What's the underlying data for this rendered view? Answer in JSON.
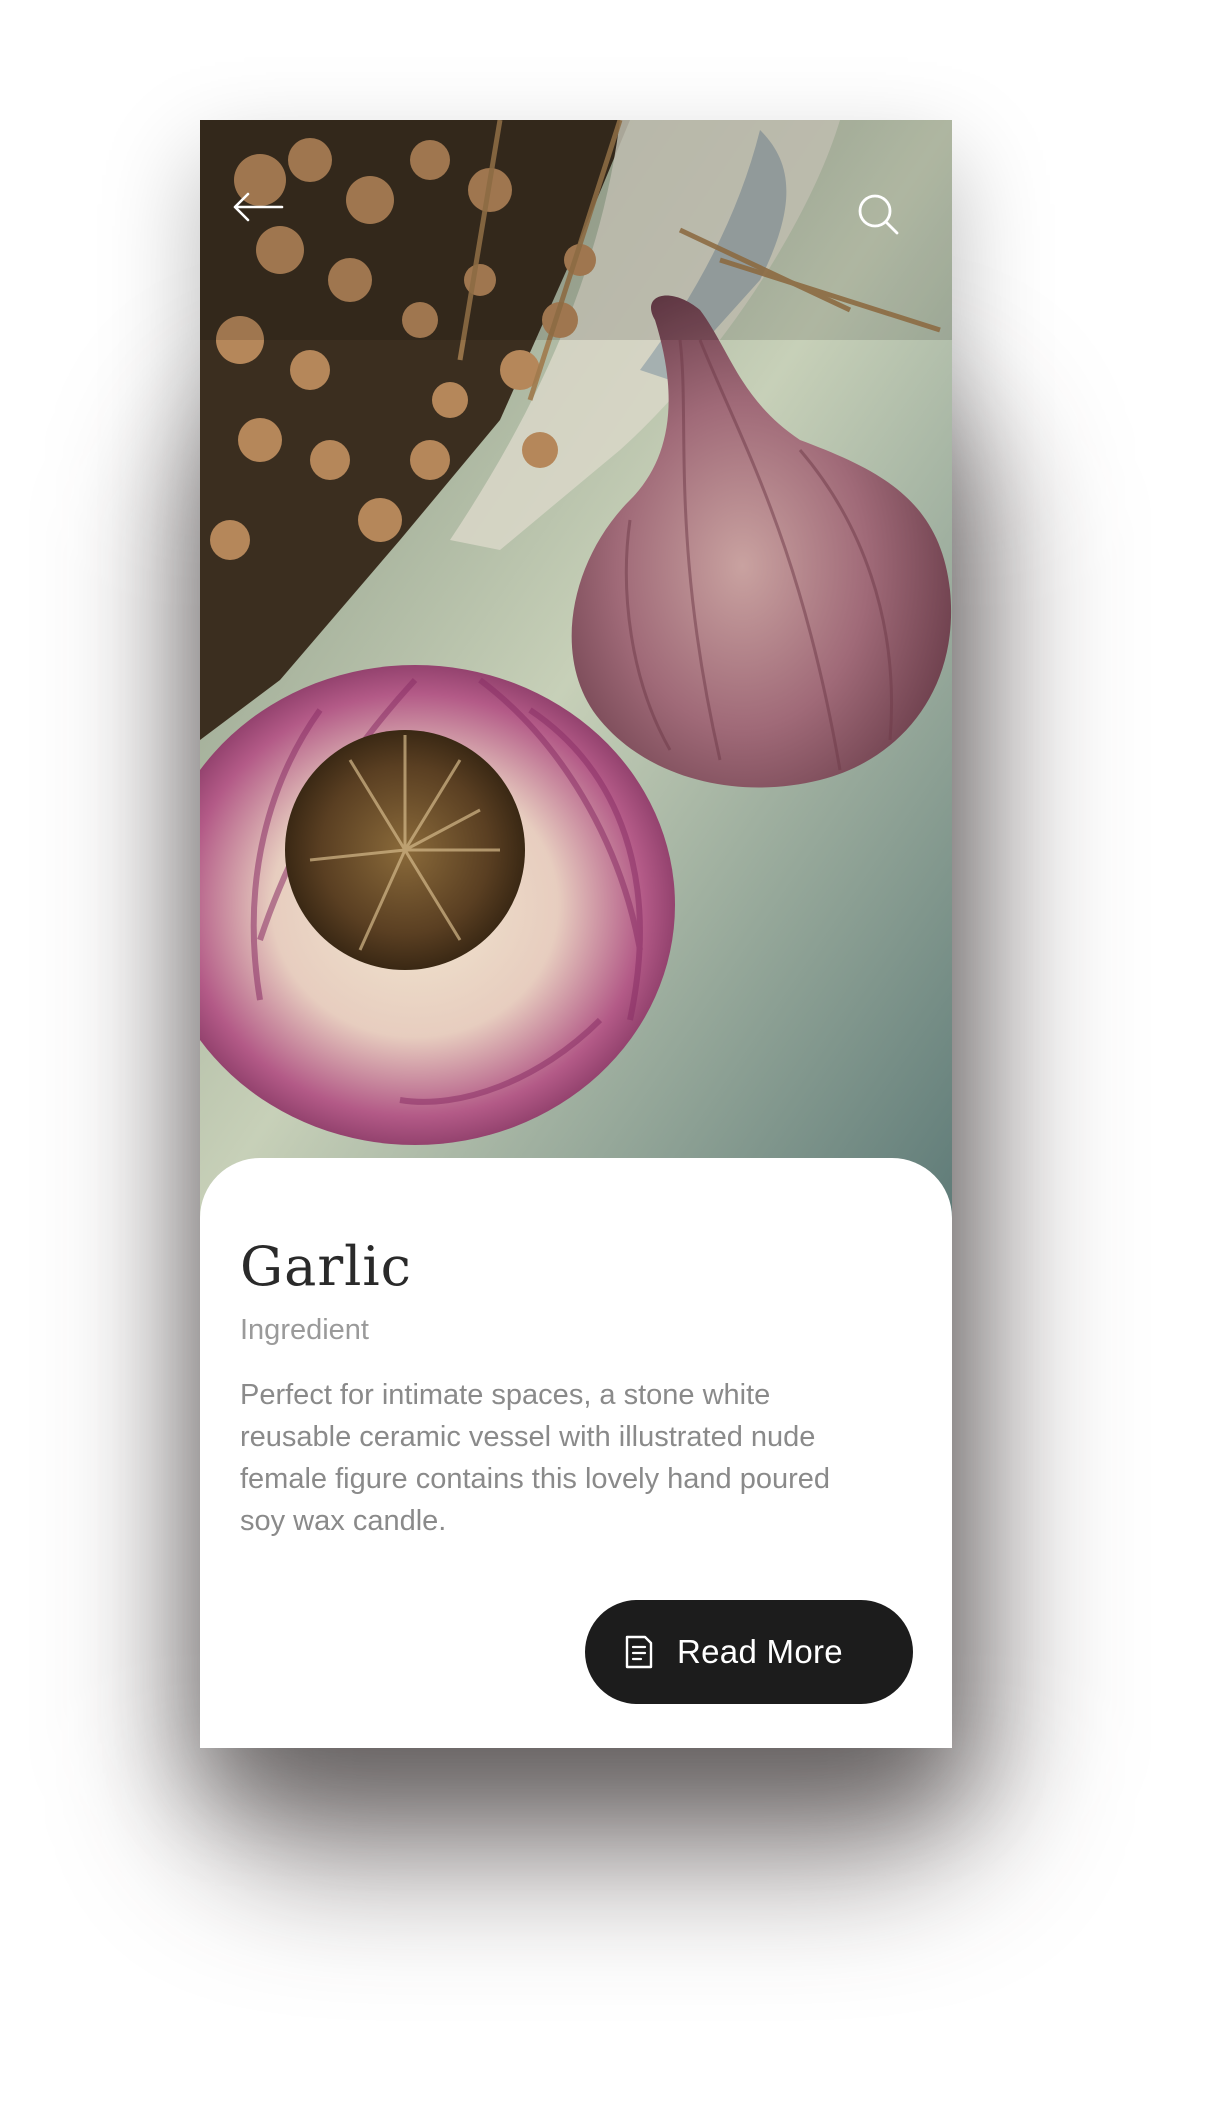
{
  "header": {
    "back_icon": "arrow-left-icon",
    "search_icon": "search-icon"
  },
  "hero": {
    "image": "garlic-bulbs-photo"
  },
  "item": {
    "title": "Garlic",
    "category": "Ingredient",
    "description": "Perfect for intimate spaces, a stone white reusable ceramic vessel with illustrated nude female figure contains this lovely hand poured soy wax candle."
  },
  "actions": {
    "read_more_label": "Read More",
    "read_more_icon": "document-icon"
  },
  "colors": {
    "button_bg": "#1c1c1c",
    "title": "#2a2a2a",
    "body_text": "#8a8a8a",
    "card_bg": "#ffffff"
  }
}
